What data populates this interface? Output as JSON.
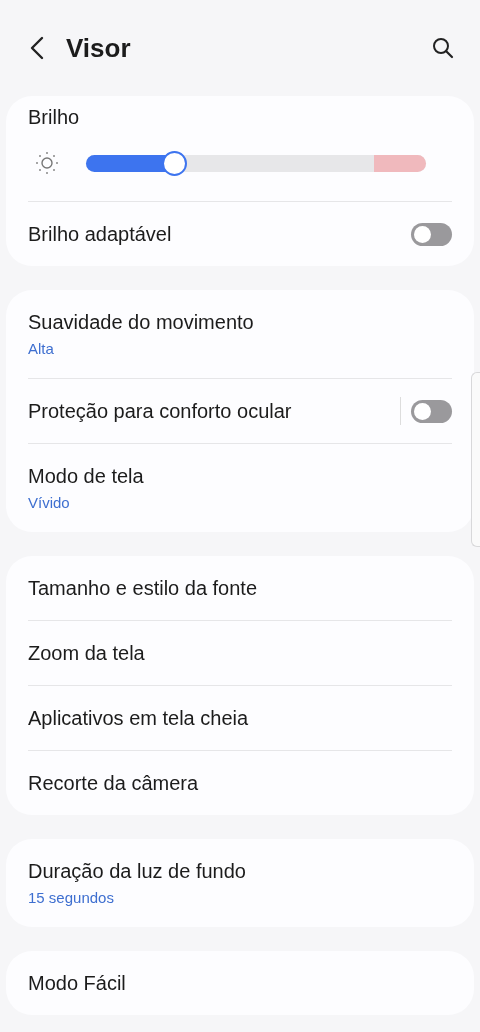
{
  "header": {
    "title": "Visor"
  },
  "sections": [
    {
      "items": [
        {
          "kind": "slider",
          "label": "Brilho",
          "level": 0.26
        },
        {
          "kind": "switch",
          "label": "Brilho adaptável",
          "on": false,
          "divider": false
        }
      ]
    },
    {
      "items": [
        {
          "kind": "value",
          "label": "Suavidade do movimento",
          "value": "Alta"
        },
        {
          "kind": "switch",
          "label": "Proteção para conforto ocular",
          "on": false,
          "divider": true
        },
        {
          "kind": "value",
          "label": "Modo de tela",
          "value": "Vívido"
        }
      ]
    },
    {
      "items": [
        {
          "kind": "plain",
          "label": "Tamanho e estilo da fonte"
        },
        {
          "kind": "plain",
          "label": "Zoom da tela"
        },
        {
          "kind": "plain",
          "label": "Aplicativos em tela cheia"
        },
        {
          "kind": "plain",
          "label": "Recorte da câmera"
        }
      ]
    },
    {
      "items": [
        {
          "kind": "value",
          "label": "Duração da luz de fundo",
          "value": "15 segundos"
        }
      ]
    },
    {
      "items": [
        {
          "kind": "plain",
          "label": "Modo Fácil"
        }
      ]
    }
  ]
}
